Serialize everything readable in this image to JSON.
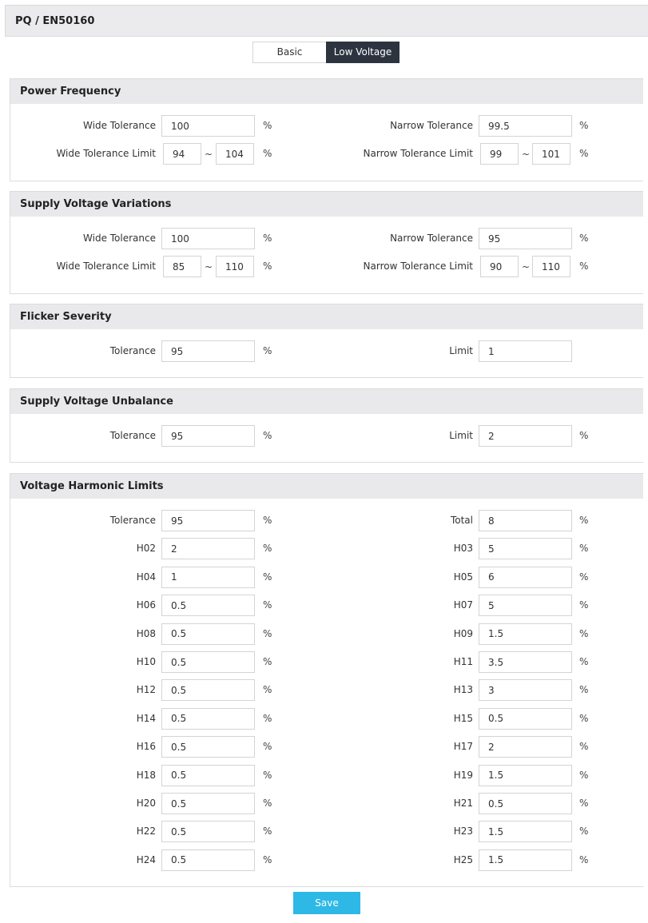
{
  "header": {
    "title": "PQ / EN50160"
  },
  "tabs": [
    {
      "label": "Basic"
    },
    {
      "label": "Low Voltage"
    }
  ],
  "power_frequency": {
    "title": "Power Frequency",
    "wide_tolerance_label": "Wide Tolerance",
    "wide_tolerance": "100",
    "wide_tolerance_unit": "%",
    "narrow_tolerance_label": "Narrow Tolerance",
    "narrow_tolerance": "99.5",
    "narrow_tolerance_unit": "%",
    "wide_limit_label": "Wide Tolerance Limit",
    "wide_limit_min": "94",
    "wide_limit_sep": "~",
    "wide_limit_max": "104",
    "wide_limit_unit": "%",
    "narrow_limit_label": "Narrow Tolerance Limit",
    "narrow_limit_min": "99",
    "narrow_limit_sep": "~",
    "narrow_limit_max": "101",
    "narrow_limit_unit": "%"
  },
  "supply_voltage_variations": {
    "title": "Supply Voltage Variations",
    "wide_tolerance_label": "Wide Tolerance",
    "wide_tolerance": "100",
    "wide_tolerance_unit": "%",
    "narrow_tolerance_label": "Narrow Tolerance",
    "narrow_tolerance": "95",
    "narrow_tolerance_unit": "%",
    "wide_limit_label": "Wide Tolerance Limit",
    "wide_limit_min": "85",
    "wide_limit_sep": "~",
    "wide_limit_max": "110",
    "wide_limit_unit": "%",
    "narrow_limit_label": "Narrow Tolerance Limit",
    "narrow_limit_min": "90",
    "narrow_limit_sep": "~",
    "narrow_limit_max": "110",
    "narrow_limit_unit": "%"
  },
  "flicker_severity": {
    "title": "Flicker Severity",
    "tolerance_label": "Tolerance",
    "tolerance": "95",
    "tolerance_unit": "%",
    "limit_label": "Limit",
    "limit": "1"
  },
  "supply_voltage_unbalance": {
    "title": "Supply Voltage Unbalance",
    "tolerance_label": "Tolerance",
    "tolerance": "95",
    "tolerance_unit": "%",
    "limit_label": "Limit",
    "limit": "2",
    "limit_unit": "%"
  },
  "voltage_harmonic_limits": {
    "title": "Voltage Harmonic Limits",
    "rows": [
      {
        "left_label": "Tolerance",
        "left_value": "95",
        "left_unit": "%",
        "right_label": "Total",
        "right_value": "8",
        "right_unit": "%"
      },
      {
        "left_label": "H02",
        "left_value": "2",
        "left_unit": "%",
        "right_label": "H03",
        "right_value": "5",
        "right_unit": "%"
      },
      {
        "left_label": "H04",
        "left_value": "1",
        "left_unit": "%",
        "right_label": "H05",
        "right_value": "6",
        "right_unit": "%"
      },
      {
        "left_label": "H06",
        "left_value": "0.5",
        "left_unit": "%",
        "right_label": "H07",
        "right_value": "5",
        "right_unit": "%"
      },
      {
        "left_label": "H08",
        "left_value": "0.5",
        "left_unit": "%",
        "right_label": "H09",
        "right_value": "1.5",
        "right_unit": "%"
      },
      {
        "left_label": "H10",
        "left_value": "0.5",
        "left_unit": "%",
        "right_label": "H11",
        "right_value": "3.5",
        "right_unit": "%"
      },
      {
        "left_label": "H12",
        "left_value": "0.5",
        "left_unit": "%",
        "right_label": "H13",
        "right_value": "3",
        "right_unit": "%"
      },
      {
        "left_label": "H14",
        "left_value": "0.5",
        "left_unit": "%",
        "right_label": "H15",
        "right_value": "0.5",
        "right_unit": "%"
      },
      {
        "left_label": "H16",
        "left_value": "0.5",
        "left_unit": "%",
        "right_label": "H17",
        "right_value": "2",
        "right_unit": "%"
      },
      {
        "left_label": "H18",
        "left_value": "0.5",
        "left_unit": "%",
        "right_label": "H19",
        "right_value": "1.5",
        "right_unit": "%"
      },
      {
        "left_label": "H20",
        "left_value": "0.5",
        "left_unit": "%",
        "right_label": "H21",
        "right_value": "0.5",
        "right_unit": "%"
      },
      {
        "left_label": "H22",
        "left_value": "0.5",
        "left_unit": "%",
        "right_label": "H23",
        "right_value": "1.5",
        "right_unit": "%"
      },
      {
        "left_label": "H24",
        "left_value": "0.5",
        "left_unit": "%",
        "right_label": "H25",
        "right_value": "1.5",
        "right_unit": "%"
      }
    ]
  },
  "save_label": "Save"
}
